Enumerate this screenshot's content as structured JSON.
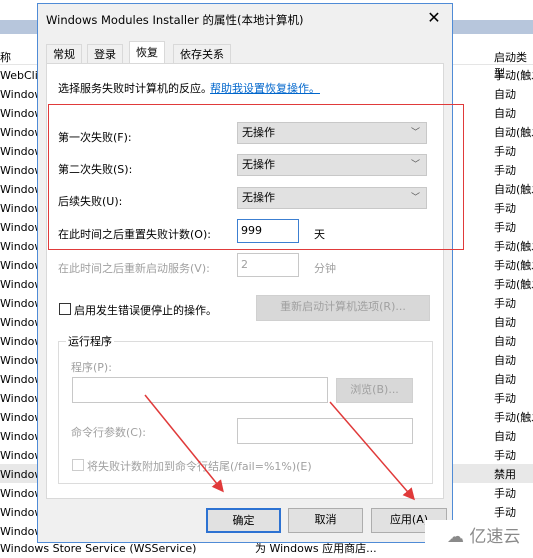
{
  "background": {
    "header_left": "称",
    "header_right": "启动类型",
    "left_rows": [
      "WebCli",
      "Window",
      "Window",
      "Window",
      "Window",
      "Window",
      "Window",
      "Window",
      "Window",
      "Window",
      "Window",
      "Window",
      "Window",
      "Window",
      "Window",
      "Window",
      "Window",
      "Window",
      "Window",
      "Window",
      "Window",
      "Window",
      "Window",
      "Window",
      "Window"
    ],
    "right_rows": [
      "手动(触发",
      "自动",
      "自动",
      "自动(触发",
      "手动",
      "手动",
      "自动(触发",
      "手动",
      "手动",
      "手动(触发",
      "手动(触发",
      "手动(触发",
      "手动",
      "自动",
      "自动",
      "自动",
      "自动",
      "手动",
      "手动(触发",
      "自动",
      "手动",
      "禁用",
      "手动",
      "手动"
    ],
    "bottom_name": "Windows Store Service (WSService)",
    "bottom_desc": "为 Windows 应用商店..."
  },
  "dialog": {
    "title": "Windows Modules Installer 的属性(本地计算机)",
    "close_icon": "close-icon",
    "tabs": [
      {
        "label": "常规"
      },
      {
        "label": "登录"
      },
      {
        "label": "恢复",
        "active": true
      },
      {
        "label": "依存关系"
      }
    ],
    "intro": "选择服务失败时计算机的反应。",
    "help_link": "帮助我设置恢复操作。",
    "first_failure_label": "第一次失败(F):",
    "first_failure_value": "无操作",
    "second_failure_label": "第二次失败(S):",
    "second_failure_value": "无操作",
    "subsequent_label": "后续失败(U):",
    "subsequent_value": "无操作",
    "reset_label": "在此时间之后重置失败计数(O):",
    "reset_value": "999",
    "reset_unit": "天",
    "restart_label": "在此时间之后重新启动服务(V):",
    "restart_value": "2",
    "restart_unit": "分钟",
    "enable_stop_label": "启用发生错误便停止的操作。",
    "restart_options_button": "重新启动计算机选项(R)...",
    "run_program_group": "运行程序",
    "program_label": "程序(P):",
    "browse_button": "浏览(B)...",
    "args_label": "命令行参数(C):",
    "append_label": "将失败计数附加到命令行结尾(/fail=%1%)(E)",
    "ok_button": "确定",
    "cancel_button": "取消",
    "apply_button": "应用(A)"
  },
  "annotation_color": "#e03a3a",
  "watermark": "亿速云"
}
